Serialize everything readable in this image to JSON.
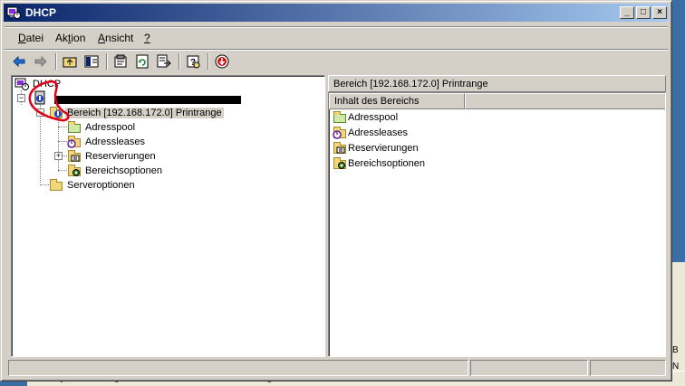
{
  "window": {
    "title": "DHCP",
    "minimize_glyph": "_",
    "maximize_glyph": "□",
    "close_glyph": "×"
  },
  "menu": {
    "items": [
      {
        "pre": "",
        "key": "D",
        "post": "atei"
      },
      {
        "pre": "Ak",
        "key": "t",
        "post": "ion"
      },
      {
        "pre": "",
        "key": "A",
        "post": "nsicht"
      },
      {
        "pre": "",
        "key": "?",
        "post": ""
      }
    ]
  },
  "toolbar": {
    "icons": [
      "back-arrow-icon",
      "forward-arrow-icon",
      "up-folder-icon",
      "show-hide-tree-icon",
      "properties-icon",
      "refresh-icon",
      "export-list-icon",
      "help-icon",
      "stop-icon"
    ]
  },
  "tree": {
    "root": "DHCP",
    "scope": "Bereich [192.168.172.0] Printrange",
    "children": [
      "Adresspool",
      "Adressleases",
      "Reservierungen",
      "Bereichsoptionen"
    ],
    "server_options": "Serveroptionen"
  },
  "right_pane": {
    "header": "Bereich [192.168.172.0] Printrange",
    "column": "Inhalt des Bereichs",
    "items": [
      "Adresspool",
      "Adressleases",
      "Reservierungen",
      "Bereichsoptionen"
    ]
  },
  "background": {
    "row_text": "Systemmeldung 24.12.2007 ... Service Control Manager ... 7036",
    "right_letters": [
      "B",
      "N"
    ]
  },
  "colors": {
    "titlebar_start": "#0a246a",
    "titlebar_end": "#a6caf0",
    "annotation": "#e0001a",
    "redaction": "#000000"
  }
}
